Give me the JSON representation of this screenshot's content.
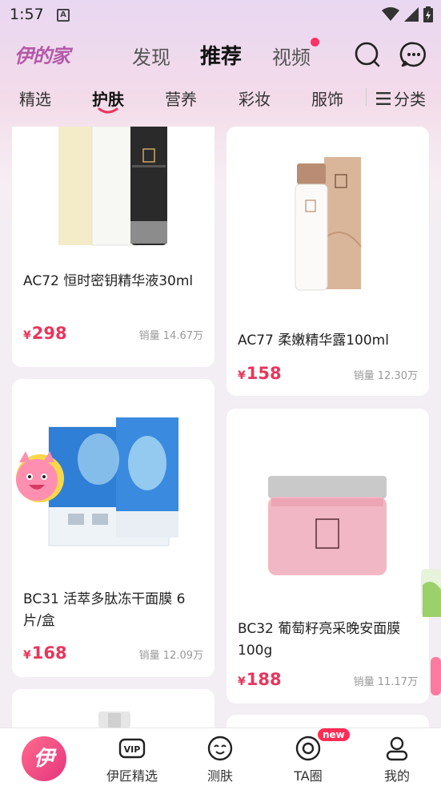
{
  "status_bar": {
    "time": "1:57",
    "notification_icon": "A"
  },
  "header": {
    "logo": "伊的家",
    "tabs": [
      {
        "label": "发现",
        "active": false
      },
      {
        "label": "推荐",
        "active": true
      },
      {
        "label": "视频",
        "active": false,
        "badge_dot": true
      }
    ]
  },
  "categories": {
    "items": [
      {
        "label": "精选",
        "active": false
      },
      {
        "label": "护肤",
        "active": true
      },
      {
        "label": "营养",
        "active": false
      },
      {
        "label": "彩妆",
        "active": false
      },
      {
        "label": "服饰",
        "active": false
      }
    ],
    "menu_label": "分类"
  },
  "products": [
    {
      "title": "AC72 恒时密钥精华液30ml",
      "currency": "¥",
      "price": "298",
      "sales": "销量 14.67万"
    },
    {
      "title": "AC77 柔嫩精华露100ml",
      "currency": "¥",
      "price": "158",
      "sales": "销量 12.30万"
    },
    {
      "title": "BC31 活萃多肽冻干面膜 6片/盒",
      "currency": "¥",
      "price": "168",
      "sales": "销量 12.09万"
    },
    {
      "title": "BC32 葡萄籽亮采晚安面膜100g",
      "currency": "¥",
      "price": "188",
      "sales": "销量 11.17万"
    }
  ],
  "bottom_nav": {
    "home_label": "伊",
    "items": [
      {
        "label": "伊匠精选",
        "icon": "vip-icon"
      },
      {
        "label": "测肤",
        "icon": "smile-face-icon"
      },
      {
        "label": "TA圈",
        "icon": "ta-circle-icon",
        "badge": "new"
      },
      {
        "label": "我的",
        "icon": "profile-icon"
      }
    ],
    "vip_text": "VIP"
  },
  "colors": {
    "accent": "#e8365d",
    "logo": "#b35aa8",
    "badge": "#ff2d55"
  }
}
